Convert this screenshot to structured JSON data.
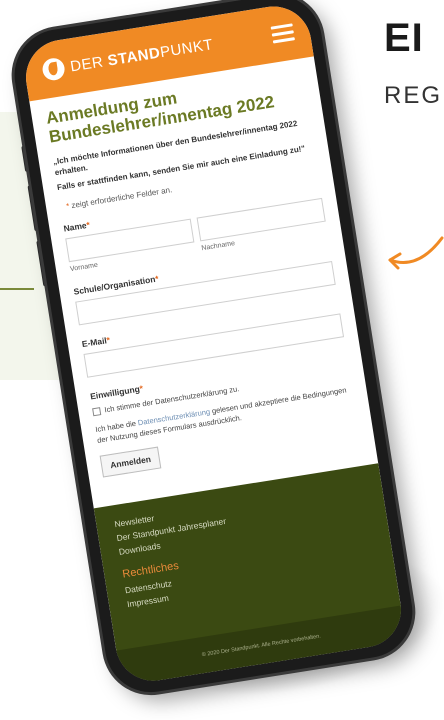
{
  "promo": {
    "headline": "EI",
    "subline": "REG",
    "accent_color": "#f08a24"
  },
  "app": {
    "brand_prefix": "DER ",
    "brand_bold": "STAND",
    "brand_suffix": "PUNKT",
    "menu_icon": "hamburger-icon",
    "bar_color": "#f08a24"
  },
  "form": {
    "title": "Anmeldung zum Bundeslehrer/innentag 2022",
    "intro_1": "„Ich möchte Informationen über den Bundeslehrer/innentag 2022 erhalten.",
    "intro_2": "Falls er stattfinden kann, senden Sie mir auch eine Einladung zu!\"",
    "required_note": "zeigt erforderliche Felder an.",
    "required_star": "*",
    "name_label": "Name",
    "first_name_sub": "Vorname",
    "last_name_sub": "Nachname",
    "school_label": "Schule/Organisation",
    "email_label": "E-Mail",
    "consent_label": "Einwilligung",
    "consent_checkbox_text": "Ich stimme der Datenschutzerklärung zu.",
    "terms_prefix": "Ich habe die ",
    "terms_link": "Datenschutzerklärung",
    "terms_suffix": " gelesen und akzeptiere die Bedingungen der Nutzung dieses Formulars ausdrücklich.",
    "submit_label": "Anmelden"
  },
  "footer": {
    "links": [
      "Newsletter",
      "Der Standpunkt Jahresplaner",
      "Downloads"
    ],
    "legal_heading": "Rechtliches",
    "legal_links": [
      "Datenschutz",
      "Impressum"
    ],
    "copyright": "© 2020 Der Standpunkt. Alle Rechte vorbehalten.",
    "background_color": "#3b4a12",
    "heading_color": "#e98a3a"
  }
}
